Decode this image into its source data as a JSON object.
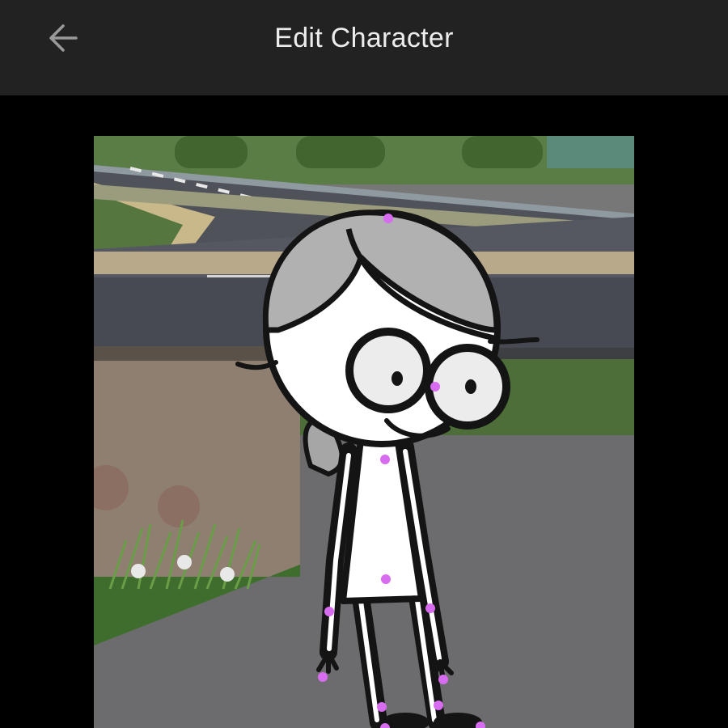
{
  "header": {
    "title": "Edit Character",
    "back_icon": "arrow-left-icon"
  },
  "editor": {
    "joint_color": "#d86cf0",
    "joint_count": 12,
    "character_outline": "#141414",
    "hair_color": "#b1b1b1"
  }
}
